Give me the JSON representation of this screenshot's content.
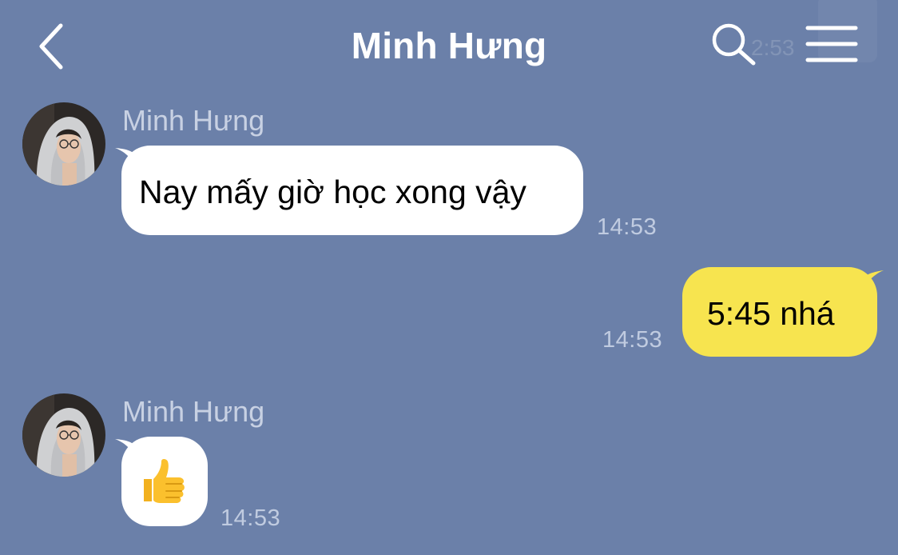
{
  "header": {
    "title": "Minh Hưng",
    "back_icon": "chevron-left-icon",
    "search_icon": "search-icon",
    "menu_icon": "hamburger-menu-icon",
    "ghost_time": "2:53"
  },
  "colors": {
    "background": "#6b80a9",
    "incoming_bubble": "#ffffff",
    "outgoing_bubble": "#f7e44f",
    "header_text": "#ffffff"
  },
  "messages": [
    {
      "direction": "incoming",
      "sender": "Minh Hưng",
      "text": "Nay mấy giờ học xong vậy",
      "time": "14:53"
    },
    {
      "direction": "outgoing",
      "text": "5:45 nhá",
      "time": "14:53"
    },
    {
      "direction": "incoming",
      "sender": "Minh Hưng",
      "sticker": "thumbs-up-emoji",
      "text": "👍",
      "time": "14:53"
    }
  ]
}
